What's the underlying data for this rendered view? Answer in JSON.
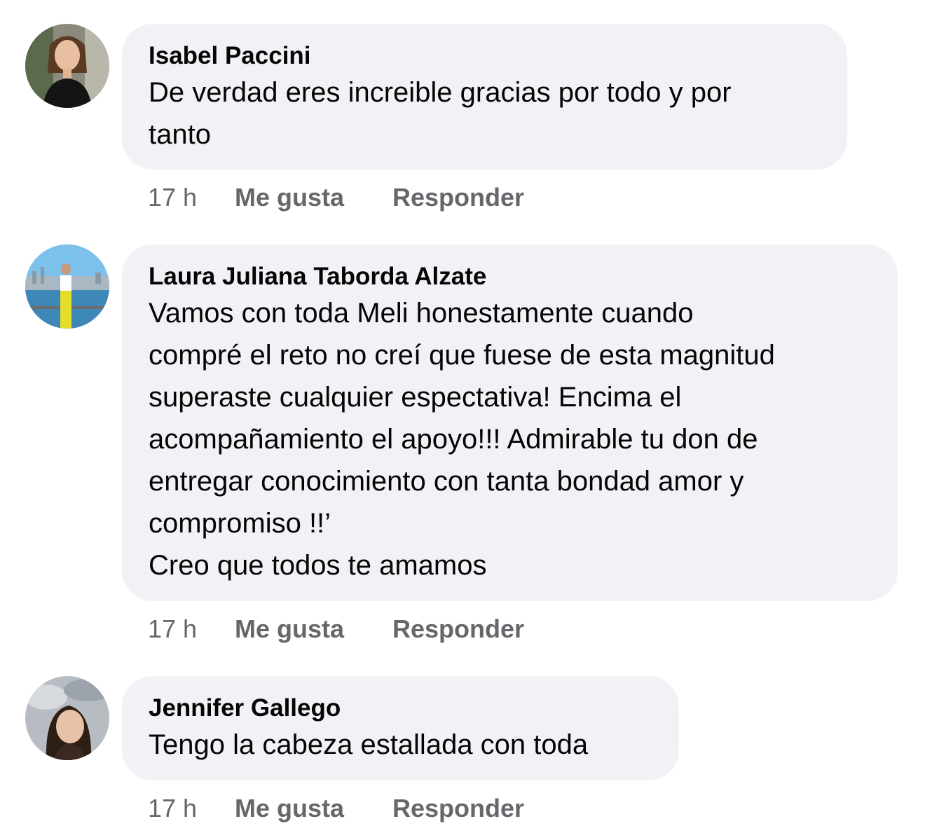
{
  "comments": [
    {
      "author": "Isabel Paccini",
      "text_lines": [
        "De verdad eres increible gracias por todo y por",
        "tanto"
      ],
      "time": "17 h",
      "like_label": "Me gusta",
      "reply_label": "Responder",
      "avatar_icon": "profile-photo-woman-black-top"
    },
    {
      "author": "Laura Juliana Taborda Alzate",
      "text_lines": [
        "Vamos con toda Meli honestamente cuando",
        "compré el reto no creí que fuese de esta magnitud",
        "superaste cualquier espectativa! Encima el",
        "acompañamiento el apoyo!!! Admirable tu don de",
        "entregar conocimiento con tanta bondad amor y",
        "compromiso !!’",
        "Creo que todos te amamos"
      ],
      "time": "17 h",
      "like_label": "Me gusta",
      "reply_label": "Responder",
      "avatar_icon": "profile-photo-woman-city-skyline"
    },
    {
      "author": "Jennifer Gallego",
      "text_lines": [
        "Tengo la cabeza estallada con toda"
      ],
      "time": "17 h",
      "like_label": "Me gusta",
      "reply_label": "Responder",
      "avatar_icon": "profile-photo-woman-cloudy-sky"
    }
  ],
  "colors": {
    "bubble_bg": "#f0f2f5",
    "secondary_text": "#65676b",
    "primary_text": "#050505"
  }
}
